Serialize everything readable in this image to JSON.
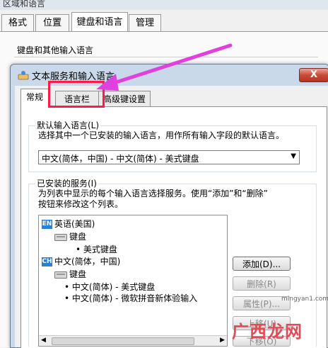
{
  "background_window": {
    "title": "区域和语言",
    "tabs": [
      {
        "label": "格式"
      },
      {
        "label": "位置"
      },
      {
        "label": "键盘和语言"
      },
      {
        "label": "管理"
      }
    ],
    "group_label": "键盘和其他输入语言"
  },
  "dialog": {
    "title": "文本服务和输入语言",
    "close_label": "X",
    "tabs": [
      {
        "label": "常规"
      },
      {
        "label": "语言栏"
      },
      {
        "label": "高级键设置"
      }
    ],
    "default_language": {
      "label": "默认输入语言(L)",
      "description": "选择其中一个已安装的输入语言，用作所有输入字段的默认语言。",
      "selected": "中文(简体，中国) - 中文(简体) - 美式键盘"
    },
    "installed_services": {
      "label": "已安装的服务(I)",
      "description_line1": "为列表中显示的每个输入语言选择服务。使用“添加”和“删除”",
      "description_line2": "按钮来修改这个列表。",
      "tree": [
        {
          "text": "英语(美国)",
          "badge": "EN"
        },
        {
          "text": "键盘"
        },
        {
          "text": "• 美式键盘"
        },
        {
          "text": "中文(简体，中国)",
          "badge": "CH"
        },
        {
          "text": "键盘"
        },
        {
          "text": "• 中文(简体) - 美式键盘"
        },
        {
          "text": "• 中文(简体) - 微软拼音新体验输入"
        }
      ]
    },
    "buttons": {
      "add": "添加(D)...",
      "remove": "删除(R)",
      "properties": "属性(P)...",
      "move_up": "上移(U)",
      "move_down": "下移(O)"
    }
  },
  "watermark": {
    "text": "广西龙网",
    "site": "mingyan1.com"
  },
  "colors": {
    "highlight": "#ff1a4a",
    "arrow": "#e040e0"
  }
}
